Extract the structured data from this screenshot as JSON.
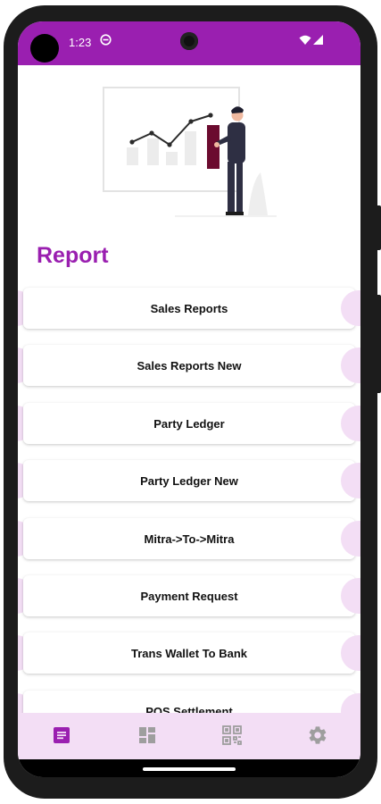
{
  "status": {
    "time": "1:23"
  },
  "page": {
    "title": "Report"
  },
  "reports": [
    {
      "label": "Sales Reports"
    },
    {
      "label": "Sales Reports New"
    },
    {
      "label": "Party Ledger"
    },
    {
      "label": "Party Ledger New"
    },
    {
      "label": "Mitra->To->Mitra"
    },
    {
      "label": "Payment Request"
    },
    {
      "label": "Trans Wallet To Bank"
    },
    {
      "label": "POS Settlement"
    }
  ],
  "nav": {
    "items": [
      {
        "icon": "report-icon",
        "active": true
      },
      {
        "icon": "dashboard-icon",
        "active": false
      },
      {
        "icon": "qr-code-icon",
        "active": false
      },
      {
        "icon": "settings-icon",
        "active": false
      }
    ]
  },
  "colors": {
    "brand": "#9a1fb0",
    "nav_bg": "#f3def5",
    "blob": "#f3def5",
    "icon_inactive": "#9e9e9e"
  }
}
